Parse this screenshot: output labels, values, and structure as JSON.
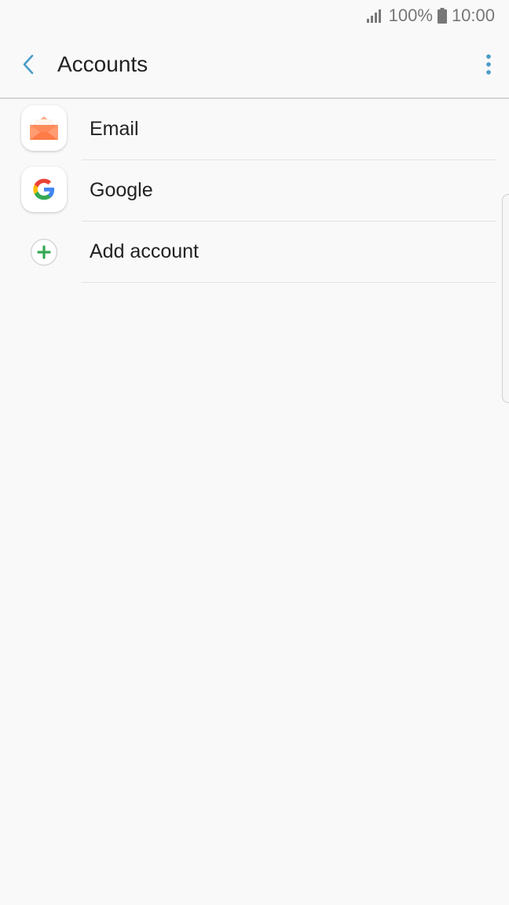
{
  "status_bar": {
    "signal_icon": "signal-icon",
    "battery_percent": "100%",
    "battery_icon": "battery-icon",
    "time": "10:00"
  },
  "app_bar": {
    "title": "Accounts",
    "back_icon": "chevron-left-icon",
    "more_icon": "more-vertical-icon",
    "accent_color": "#4a9cc9"
  },
  "accounts": [
    {
      "label": "Email",
      "icon": "email-icon",
      "icon_color": "#ff8a5c"
    },
    {
      "label": "Google",
      "icon": "google-icon"
    },
    {
      "label": "Add account",
      "icon": "add-icon",
      "icon_color": "#34a853"
    }
  ]
}
